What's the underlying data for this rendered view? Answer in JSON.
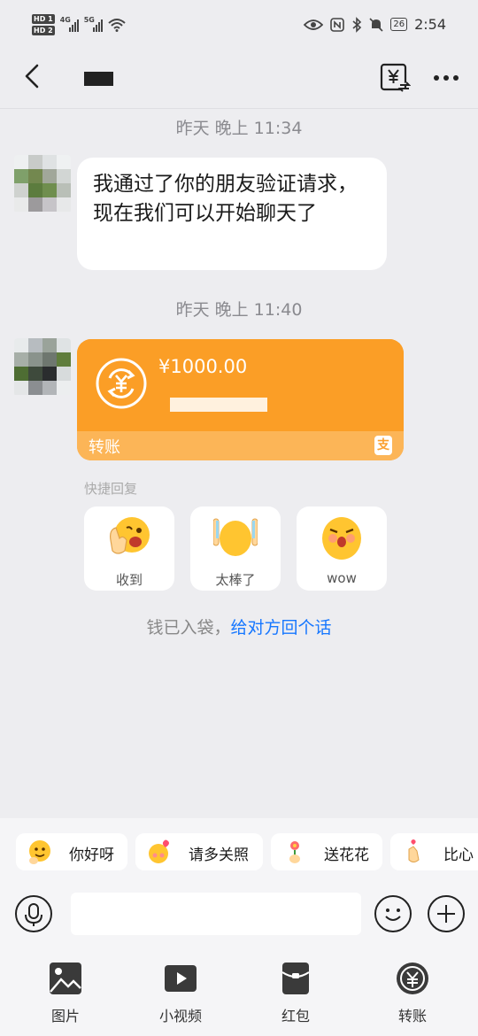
{
  "status_bar": {
    "hd1": "HD 1",
    "hd2": "HD 2",
    "net1": "4G",
    "net2": "5G",
    "battery": "26",
    "time": "2:54"
  },
  "header": {
    "back_icon": "chevron-left-icon",
    "transfer_icon": "yuan-transfer-icon",
    "more_icon": "more-dots-icon"
  },
  "messages": [
    {
      "time": "昨天 晚上 11:34",
      "text": "我通过了你的朋友验证请求，现在我们可以开始聊天了"
    },
    {
      "time": "昨天 晚上 11:40"
    }
  ],
  "transfer": {
    "amount": "¥1000.00",
    "label": "转账",
    "badge": "支"
  },
  "quick_reply": {
    "title": "快捷回复",
    "items": [
      {
        "label": "收到",
        "icon": "ok-hand-emoji-icon"
      },
      {
        "label": "太棒了",
        "icon": "thumbs-up-emoji-icon"
      },
      {
        "label": "wow",
        "icon": "surprised-emoji-icon"
      }
    ]
  },
  "received": {
    "prefix": "钱已入袋，",
    "link": "给对方回个话"
  },
  "chips": [
    {
      "label": "你好呀",
      "icon": "wave-emoji-icon"
    },
    {
      "label": "请多关照",
      "icon": "heart-emoji-icon"
    },
    {
      "label": "送花花",
      "icon": "flower-emoji-icon"
    },
    {
      "label": "比心",
      "icon": "finger-heart-emoji-icon"
    }
  ],
  "input": {
    "placeholder": ""
  },
  "toolbar": [
    {
      "label": "图片",
      "icon": "image-icon"
    },
    {
      "label": "小视频",
      "icon": "video-icon"
    },
    {
      "label": "红包",
      "icon": "red-packet-icon"
    },
    {
      "label": "转账",
      "icon": "transfer-icon"
    }
  ]
}
